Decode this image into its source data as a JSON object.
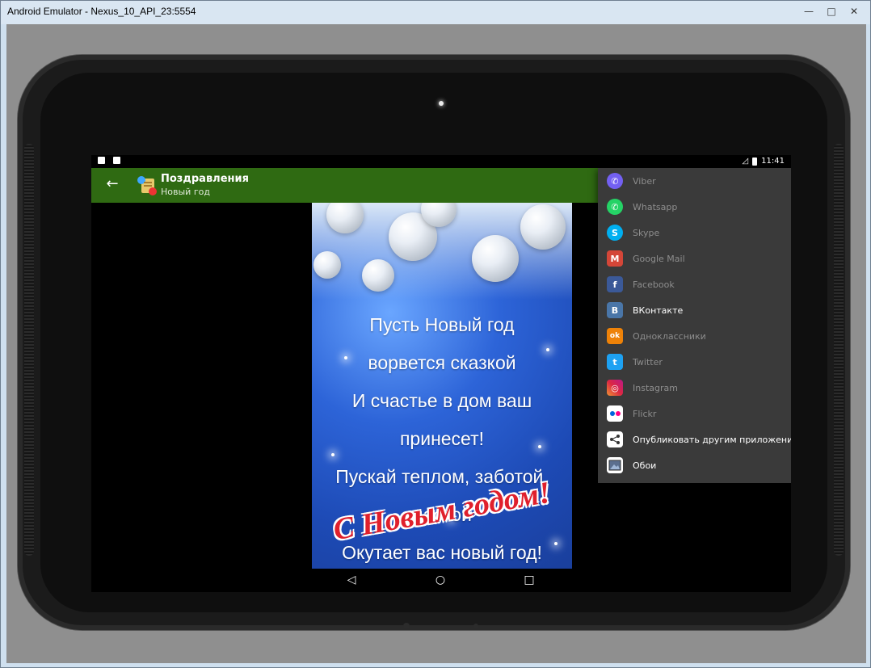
{
  "window": {
    "title": "Android Emulator - Nexus_10_API_23:5554",
    "controls": [
      "—",
      "□",
      "✕"
    ]
  },
  "statusbar": {
    "time": "11:41"
  },
  "appbar": {
    "title": "Поздравления",
    "subtitle": "Новый год"
  },
  "card": {
    "poem_lines": [
      "Пусть Новый год",
      "ворвется сказкой",
      "И счастье в дом ваш принесет!",
      "Пускай теплом, заботой, лаской",
      "Окутает вас новый год!"
    ],
    "greeting": "С Новым годом!"
  },
  "share_menu": {
    "items": [
      {
        "label": "Viber",
        "icon": "viber-icon",
        "color": "#7360f2",
        "glyph": "✆",
        "active": false
      },
      {
        "label": "Whatsapp",
        "icon": "whatsapp-icon",
        "color": "#25d366",
        "glyph": "✆",
        "active": false
      },
      {
        "label": "Skype",
        "icon": "skype-icon",
        "color": "#00aff0",
        "glyph": "S",
        "active": false
      },
      {
        "label": "Google Mail",
        "icon": "gmail-icon",
        "color": "#d44638",
        "glyph": "M",
        "active": false
      },
      {
        "label": "Facebook",
        "icon": "facebook-icon",
        "color": "#3b5998",
        "glyph": "f",
        "active": false
      },
      {
        "label": "ВКонтакте",
        "icon": "vkontakte-icon",
        "color": "#4a76a8",
        "glyph": "B",
        "active": true
      },
      {
        "label": "Одноклассники",
        "icon": "odnoklassniki-icon",
        "color": "#ee8208",
        "glyph": "ok",
        "active": false
      },
      {
        "label": "Twitter",
        "icon": "twitter-icon",
        "color": "#1da1f2",
        "glyph": "t",
        "active": false
      },
      {
        "label": "Instagram",
        "icon": "instagram-icon",
        "color": "#c13584",
        "glyph": "◎",
        "active": false
      },
      {
        "label": "Flickr",
        "icon": "flickr-icon",
        "color": "#ffffff",
        "glyph": "••",
        "active": false
      },
      {
        "label": "Опубликовать другим приложением",
        "icon": "share-icon",
        "color": "#ffffff",
        "glyph": "⟨",
        "active": true
      },
      {
        "label": "Обои",
        "icon": "wallpaper-icon",
        "color": "#ffffff",
        "glyph": "▭",
        "active": true
      }
    ]
  },
  "navbar": {
    "back": "◁",
    "home": "○",
    "recent": "□"
  }
}
